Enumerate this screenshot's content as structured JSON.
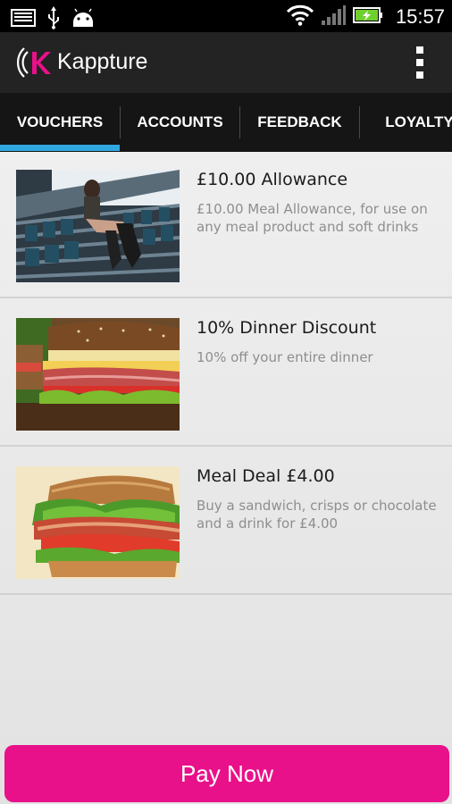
{
  "status_bar": {
    "time": "15:57",
    "icons": [
      "screenshot-icon",
      "usb-icon",
      "android-icon",
      "wifi-icon",
      "signal-icon",
      "battery-charging-icon"
    ]
  },
  "app": {
    "title": "Kappture",
    "logo_letter": "K"
  },
  "tabs": [
    {
      "label": "VOUCHERS",
      "selected": true
    },
    {
      "label": "ACCOUNTS",
      "selected": false
    },
    {
      "label": "FEEDBACK",
      "selected": false
    },
    {
      "label": "LOYALTY",
      "selected": false
    }
  ],
  "vouchers": [
    {
      "title": "£10.00 Allowance",
      "description": "£10.00 Meal Allowance, for use on any meal product and soft drinks",
      "image": "stadium-photo"
    },
    {
      "title": "10% Dinner Discount",
      "description": "10% off your entire dinner",
      "image": "sandwich-photo"
    },
    {
      "title": "Meal Deal £4.00",
      "description": "Buy a sandwich, crisps or chocolate and a drink for £4.00",
      "image": "blt-sandwich-photo"
    }
  ],
  "pay_button": {
    "label": "Pay Now"
  },
  "colors": {
    "accent": "#e8118a",
    "tab_indicator": "#2fa7e0",
    "action_bar": "#232323",
    "tab_bar": "#151515"
  }
}
